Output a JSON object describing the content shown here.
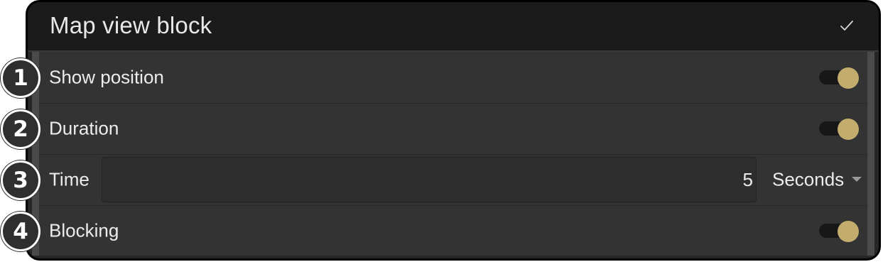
{
  "header": {
    "title": "Map view block",
    "confirm_icon": "check-icon"
  },
  "colors": {
    "panel_bg": "#262626",
    "header_bg": "#1b1b1b",
    "row_bg": "#333333",
    "toggle_knob": "#c2ad6c",
    "text": "#ececec"
  },
  "rows": [
    {
      "label": "Show position",
      "badge": "1",
      "control": "toggle",
      "enabled": true
    },
    {
      "label": "Duration",
      "badge": "2",
      "control": "toggle",
      "enabled": true
    },
    {
      "label": "Time",
      "badge": "3",
      "control": "number-input",
      "value": "5",
      "unit": "Seconds"
    },
    {
      "label": "Blocking",
      "badge": "4",
      "control": "toggle",
      "enabled": true
    }
  ]
}
